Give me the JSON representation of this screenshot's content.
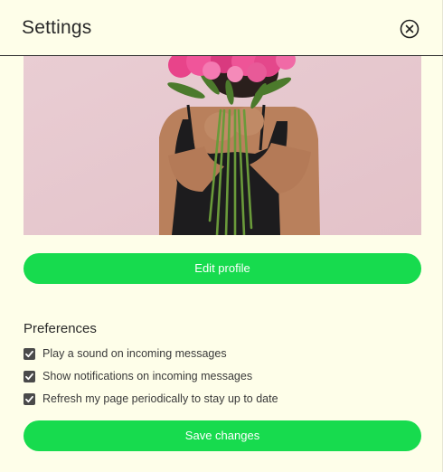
{
  "header": {
    "title": "Settings",
    "close_icon": "close-circle-icon"
  },
  "profile": {
    "image_description": "woman-holding-pink-peonies-photo",
    "edit_label": "Edit profile"
  },
  "preferences": {
    "title": "Preferences",
    "items": [
      {
        "label": "Play a sound on incoming messages",
        "checked": true
      },
      {
        "label": "Show notifications on incoming messages",
        "checked": true
      },
      {
        "label": "Refresh my page periodically to stay up to date",
        "checked": true
      }
    ]
  },
  "footer": {
    "save_label": "Save changes"
  },
  "colors": {
    "background": "#fefee9",
    "accent": "#17db4e",
    "text": "#2b2b2b"
  }
}
